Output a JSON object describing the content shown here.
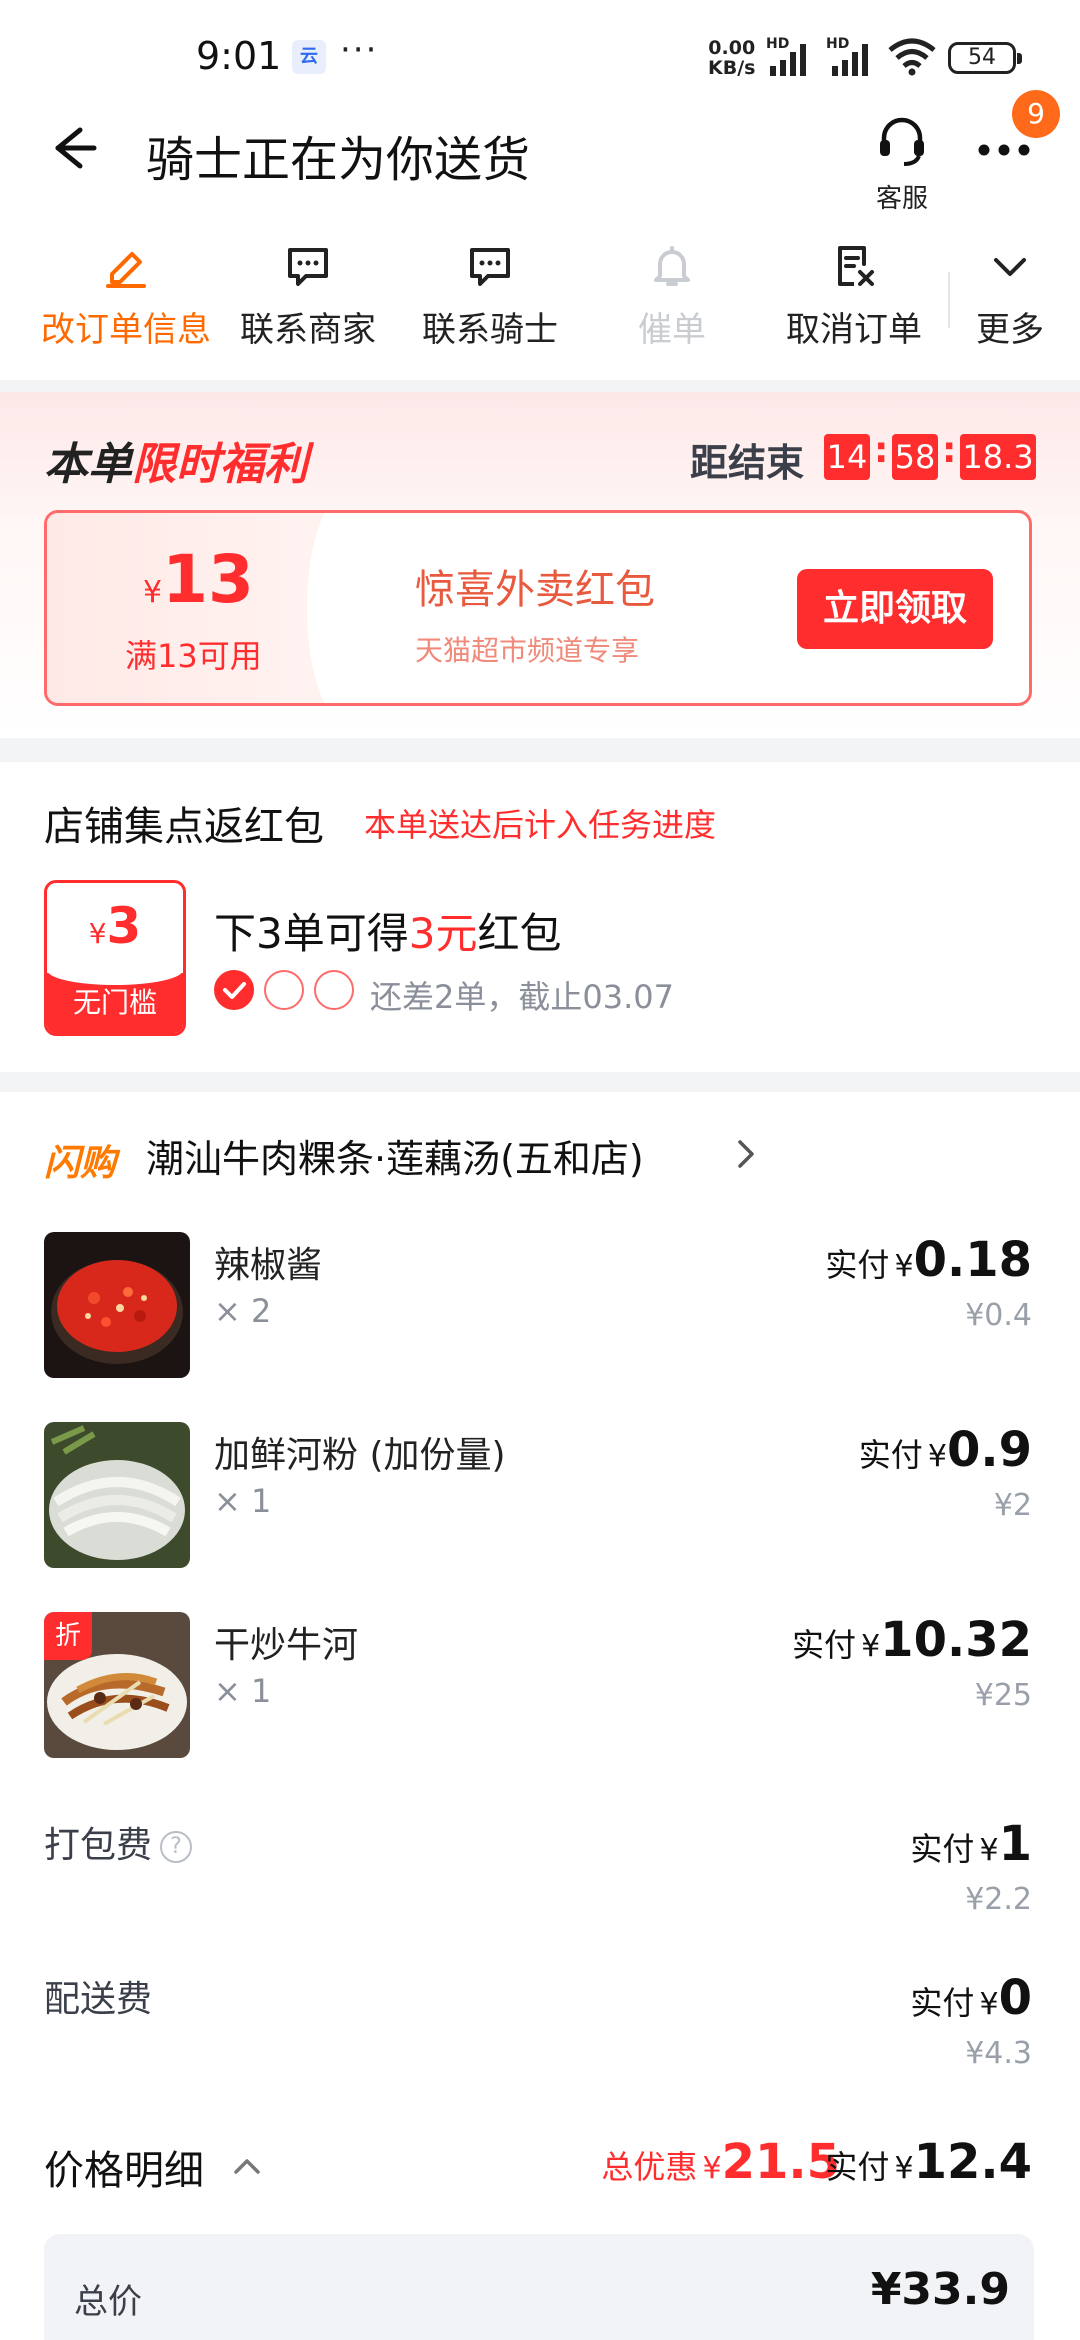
{
  "status_bar": {
    "time": "9:01",
    "app_icon_text": "云",
    "more_dots": "···",
    "net_speed_value": "0.00",
    "net_speed_unit": "KB/s",
    "hd1": "HD",
    "hd2": "HD",
    "battery": "54"
  },
  "header": {
    "title": "骑士正在为你送货",
    "customer_service_label": "客服",
    "notification_count": "9"
  },
  "actions": [
    {
      "label": "改订单信息",
      "icon": "edit-icon",
      "state": "active"
    },
    {
      "label": "联系商家",
      "icon": "chat-icon",
      "state": "normal"
    },
    {
      "label": "联系骑士",
      "icon": "chat-icon",
      "state": "normal"
    },
    {
      "label": "催单",
      "icon": "bell-icon",
      "state": "disabled"
    },
    {
      "label": "取消订单",
      "icon": "cancel-doc-icon",
      "state": "normal"
    },
    {
      "label": "更多",
      "icon": "chevron-down-icon",
      "state": "normal"
    }
  ],
  "benefit": {
    "title_prefix": "本单",
    "title_highlight": "限时福利",
    "countdown_label": "距结束",
    "countdown_h": "14",
    "countdown_m": "58",
    "countdown_s": "18.3",
    "colon": ":",
    "coupon": {
      "currency": "¥",
      "amount": "13",
      "condition": "满13可用",
      "name": "惊喜外卖红包",
      "subtitle": "天猫超市频道专享",
      "claim_button": "立即领取"
    }
  },
  "points": {
    "title": "店铺集点返红包",
    "note": "本单送达后计入任务进度",
    "redpack_currency": "¥",
    "redpack_amount": "3",
    "redpack_label": "无门槛",
    "line_prefix": "下3单可得",
    "line_highlight": "3元",
    "line_suffix": "红包",
    "progress_done": 1,
    "progress_total": 3,
    "progress_text": "还差2单，截止03.07"
  },
  "store": {
    "tag": "闪购",
    "name": "潮汕牛肉粿条·莲藕汤(五和店)"
  },
  "items": [
    {
      "name": "辣椒酱",
      "qty": "× 2",
      "paid_label": "实付",
      "currency": "¥",
      "paid": "0.18",
      "original": "¥0.4",
      "discount_tag": ""
    },
    {
      "name": "加鲜河粉 (加份量)",
      "qty": "× 1",
      "paid_label": "实付",
      "currency": "¥",
      "paid": "0.9",
      "original": "¥2",
      "discount_tag": ""
    },
    {
      "name": "干炒牛河",
      "qty": "× 1",
      "paid_label": "实付",
      "currency": "¥",
      "paid": "10.32",
      "original": "¥25",
      "discount_tag": "折"
    }
  ],
  "fees": [
    {
      "label": "打包费",
      "has_help": true,
      "paid_label": "实付",
      "currency": "¥",
      "paid": "1",
      "original": "¥2.2"
    },
    {
      "label": "配送费",
      "has_help": false,
      "paid_label": "实付",
      "currency": "¥",
      "paid": "0",
      "original": "¥4.3"
    }
  ],
  "price": {
    "title": "价格明细",
    "total_save_label": "总优惠",
    "currency": "¥",
    "total_save": "21.5",
    "paid_label": "实付",
    "paid": "12.4",
    "help_glyph": "?",
    "detail_label": "总价",
    "detail_value": "¥33.9"
  },
  "colors": {
    "accent_red": "#ff2d2d",
    "accent_orange": "#ff6a00",
    "badge_orange": "#ff6a1a"
  }
}
